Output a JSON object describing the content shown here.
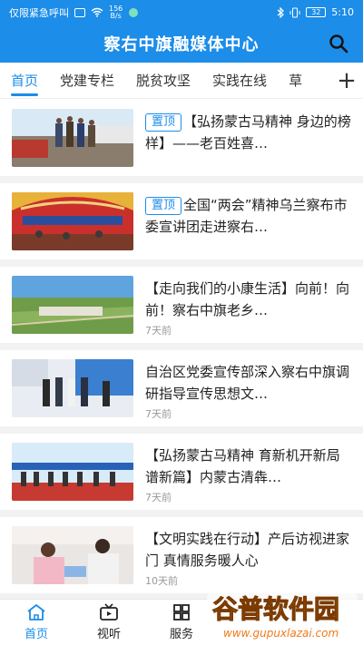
{
  "status_bar": {
    "carrier": "仅限紧急呼叫",
    "net_speed_value": "156",
    "net_speed_unit": "B/s",
    "battery": "32",
    "time": "5:10"
  },
  "header": {
    "title": "察右中旗融媒体中心",
    "search_icon": "search-icon"
  },
  "tabs": [
    {
      "label": "首页",
      "active": true
    },
    {
      "label": "党建专栏",
      "active": false
    },
    {
      "label": "脱贫攻坚",
      "active": false
    },
    {
      "label": "实践在线",
      "active": false
    },
    {
      "label": "草",
      "active": false
    }
  ],
  "tabs_more_label": "+",
  "news": [
    {
      "badge": "置顶",
      "title": "【弘扬蒙古马精神 身边的榜样】——老百姓喜…",
      "time": ""
    },
    {
      "badge": "置顶",
      "title": "全国“两会”精神乌兰察布市委宣讲团走进察右…",
      "time": ""
    },
    {
      "badge": "",
      "title": "【走向我们的小康生活】向前！向前！察右中旗老乡…",
      "time": "7天前"
    },
    {
      "badge": "",
      "title": "自治区党委宣传部深入察右中旗调研指导宣传思想文…",
      "time": "7天前"
    },
    {
      "badge": "",
      "title": "【弘扬蒙古马精神 育新机开新局谱新篇】内蒙古清犇…",
      "time": "7天前"
    },
    {
      "badge": "",
      "title": "【文明实践在行动】产后访视进家门 真情服务暖人心",
      "time": "10天前"
    }
  ],
  "bottom_nav": [
    {
      "label": "首页",
      "icon": "home-icon",
      "active": true
    },
    {
      "label": "视听",
      "icon": "tv-icon",
      "active": false
    },
    {
      "label": "服务",
      "icon": "grid-icon",
      "active": false
    }
  ],
  "watermark": {
    "brand": "谷普软件园",
    "url": "www.gupuxlazai.com"
  },
  "colors": {
    "accent": "#1c8de8",
    "divider": "#f2f2f2"
  }
}
